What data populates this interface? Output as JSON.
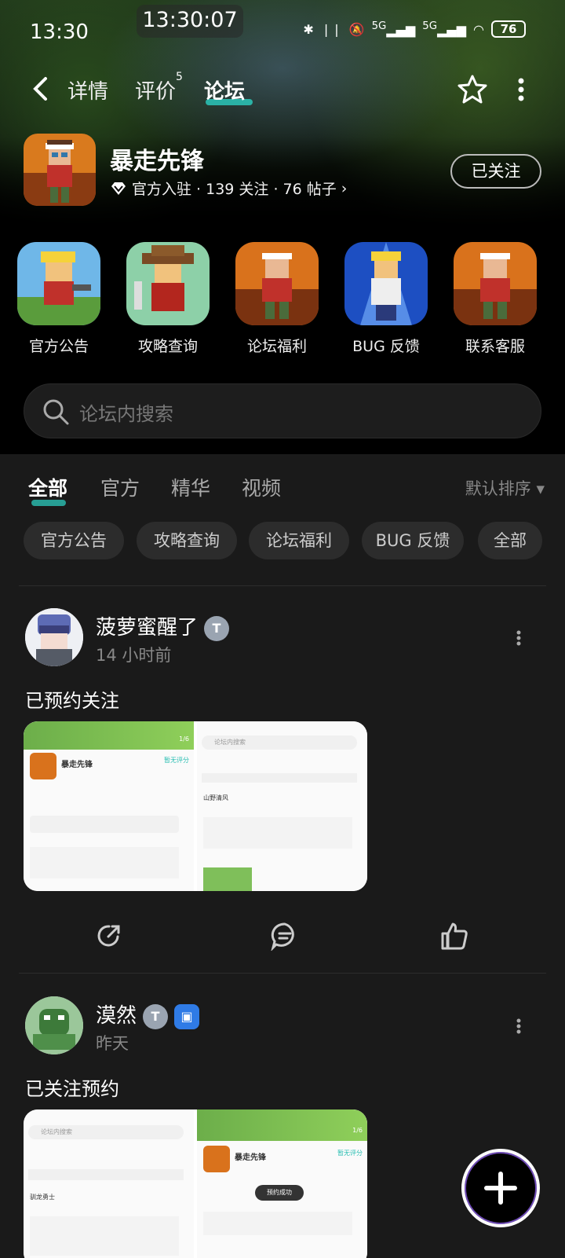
{
  "status": {
    "time": "13:30",
    "center_time": "13:30:07",
    "net1": "5G",
    "net2": "5G",
    "battery": "76"
  },
  "nav": {
    "tabs": [
      {
        "label": "详情"
      },
      {
        "label": "评价",
        "count": "5"
      },
      {
        "label": "论坛"
      }
    ]
  },
  "game": {
    "name": "暴走先锋",
    "meta": "官方入驻 · 139 关注 · 76 帖子",
    "follow_label": "已关注"
  },
  "shortcuts": [
    {
      "label": "官方公告"
    },
    {
      "label": "攻略查询"
    },
    {
      "label": "论坛福利"
    },
    {
      "label": "BUG 反馈"
    },
    {
      "label": "联系客服"
    }
  ],
  "search": {
    "placeholder": "论坛内搜索"
  },
  "filter": {
    "tabs": [
      "全部",
      "官方",
      "精华",
      "视频"
    ],
    "sort": "默认排序"
  },
  "chips": [
    "官方公告",
    "攻略查询",
    "论坛福利",
    "BUG 反馈",
    "全部"
  ],
  "posts": [
    {
      "user": "菠萝蜜醒了",
      "time": "14 小时前",
      "text": "已预约关注"
    },
    {
      "user": "漠然",
      "time": "昨天",
      "text": "已关注预约"
    }
  ],
  "thumb_text": {
    "game": "暴走先锋",
    "rating": "暂无评分",
    "search": "论坛内搜索",
    "toast": "预约成功",
    "page1": "1/6",
    "page2": "1/6",
    "user1": "山野清风",
    "user2": "驯龙勇士"
  },
  "colors": {
    "accent": "#2bbfb3",
    "background": "#1a1a1a"
  }
}
